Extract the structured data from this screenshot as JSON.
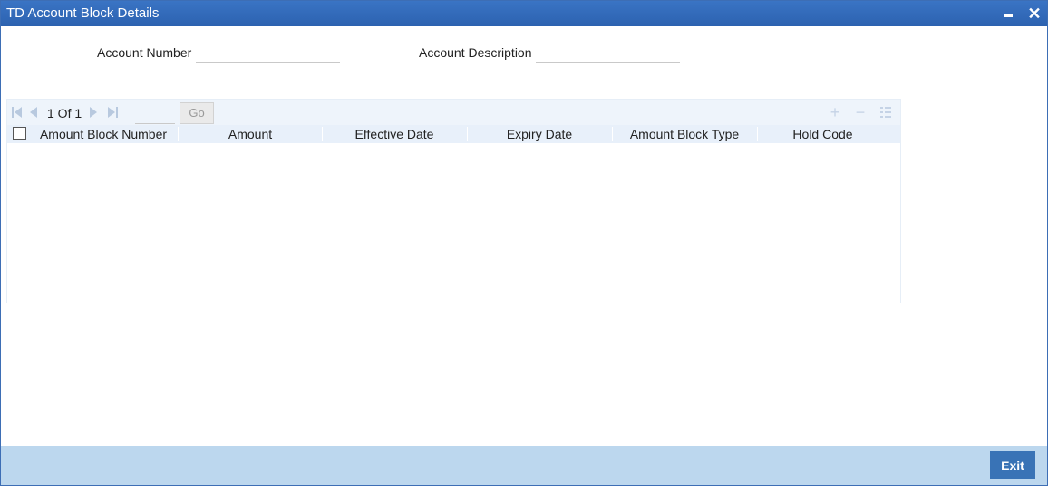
{
  "window": {
    "title": "TD Account Block Details",
    "minimize_label": "",
    "close_label": "✕"
  },
  "form": {
    "account_number_label": "Account Number",
    "account_number_value": "",
    "account_description_label": "Account Description",
    "account_description_value": ""
  },
  "grid": {
    "pager_text": "1 Of 1",
    "page_input_value": "",
    "go_label": "Go",
    "columns": [
      "Amount Block Number",
      "Amount",
      "Effective Date",
      "Expiry Date",
      "Amount Block Type",
      "Hold Code"
    ],
    "rows": [],
    "tool_icons": [
      "add-row-icon",
      "delete-row-icon",
      "single-view-icon"
    ]
  },
  "footer": {
    "exit_label": "Exit"
  },
  "colors": {
    "titlebar": "#2c62b0",
    "footer": "#bcd7ee",
    "exit_button": "#3973b6",
    "grid_header": "#e8f0fa"
  }
}
